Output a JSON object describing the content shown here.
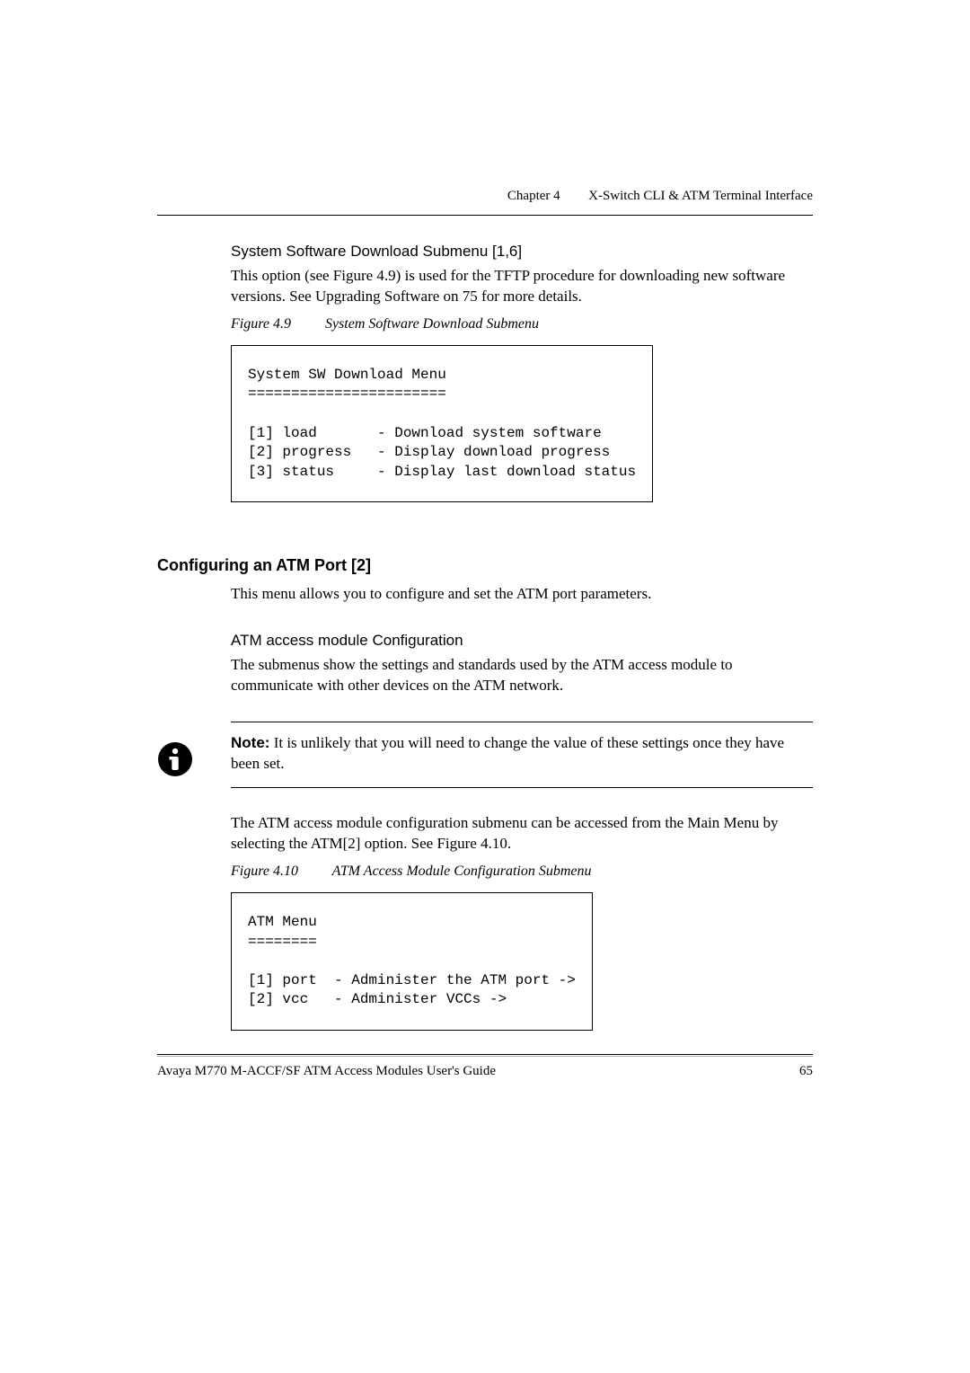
{
  "header": {
    "chapter": "Chapter 4",
    "title": "X-Switch CLI & ATM Terminal Interface"
  },
  "section1": {
    "subheading": "System Software Download Submenu [1,6]",
    "body": "This option (see Figure 4.9) is used for the TFTP procedure for downloading new software versions. See Upgrading Software on 75 for more details.",
    "figcaption_num": "Figure 4.9",
    "figcaption_title": "System Software Download Submenu",
    "code": "System SW Download Menu\n=======================\n\n[1] load       - Download system software\n[2] progress   - Display download progress\n[3] status     - Display last download status"
  },
  "section2": {
    "heading": "Configuring an ATM Port [2]",
    "intro": "This menu allows you to configure and set the ATM port parameters.",
    "subheading": "ATM access module Configuration",
    "body1": "The submenus show the settings and standards used by the ATM access module to communicate with other devices on the ATM network.",
    "note_label": "Note:",
    "note_text": "It is unlikely that you will need to change the value of these settings once they have been set.",
    "body2": "The ATM access module configuration submenu can be accessed from the Main Menu by selecting the ATM[2] option. See Figure 4.10.",
    "figcaption_num": "Figure 4.10",
    "figcaption_title": "ATM Access Module Configuration Submenu",
    "code": "ATM Menu\n========\n\n[1] port  - Administer the ATM port ->\n[2] vcc   - Administer VCCs ->"
  },
  "footer": {
    "guide": "Avaya M770 M-ACCF/SF ATM Access Modules User's Guide",
    "page": "65"
  }
}
